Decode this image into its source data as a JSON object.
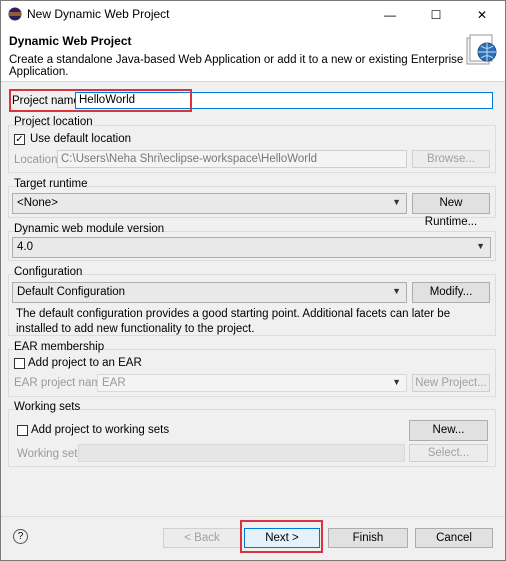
{
  "window": {
    "title": "New Dynamic Web Project",
    "minimize_glyph": "—",
    "maximize_glyph": "☐",
    "close_glyph": "✕"
  },
  "header": {
    "title": "Dynamic Web Project",
    "description": "Create a standalone Java-based Web Application or add it to a new or existing Enterprise Application."
  },
  "project_name": {
    "label": "Project name:",
    "value": "HelloWorld"
  },
  "project_location": {
    "heading": "Project location",
    "use_default_label": "Use default location",
    "use_default_checked": true,
    "location_label": "Location:",
    "location_value": "C:\\Users\\Neha Shri\\eclipse-workspace\\HelloWorld",
    "browse_label": "Browse..."
  },
  "target_runtime": {
    "heading": "Target runtime",
    "selected": "<None>",
    "new_runtime_label": "New Runtime..."
  },
  "module_version": {
    "heading": "Dynamic web module version",
    "selected": "4.0"
  },
  "configuration": {
    "heading": "Configuration",
    "selected": "Default Configuration",
    "modify_label": "Modify...",
    "description": "The default configuration provides a good starting point. Additional facets can later be installed to add new functionality to the project."
  },
  "ear": {
    "heading": "EAR membership",
    "add_label": "Add project to an EAR",
    "checked": false,
    "ear_name_label": "EAR project name:",
    "ear_name_value": "EAR",
    "new_project_label": "New Project..."
  },
  "working_sets": {
    "heading": "Working sets",
    "add_label": "Add project to working sets",
    "checked": false,
    "new_label": "New...",
    "sets_label": "Working sets:",
    "select_label": "Select..."
  },
  "footer": {
    "help_glyph": "?",
    "back_label": "< Back",
    "next_label": "Next >",
    "finish_label": "Finish",
    "cancel_label": "Cancel"
  },
  "colors": {
    "highlight": "#d9333f",
    "accent": "#0078d7"
  }
}
